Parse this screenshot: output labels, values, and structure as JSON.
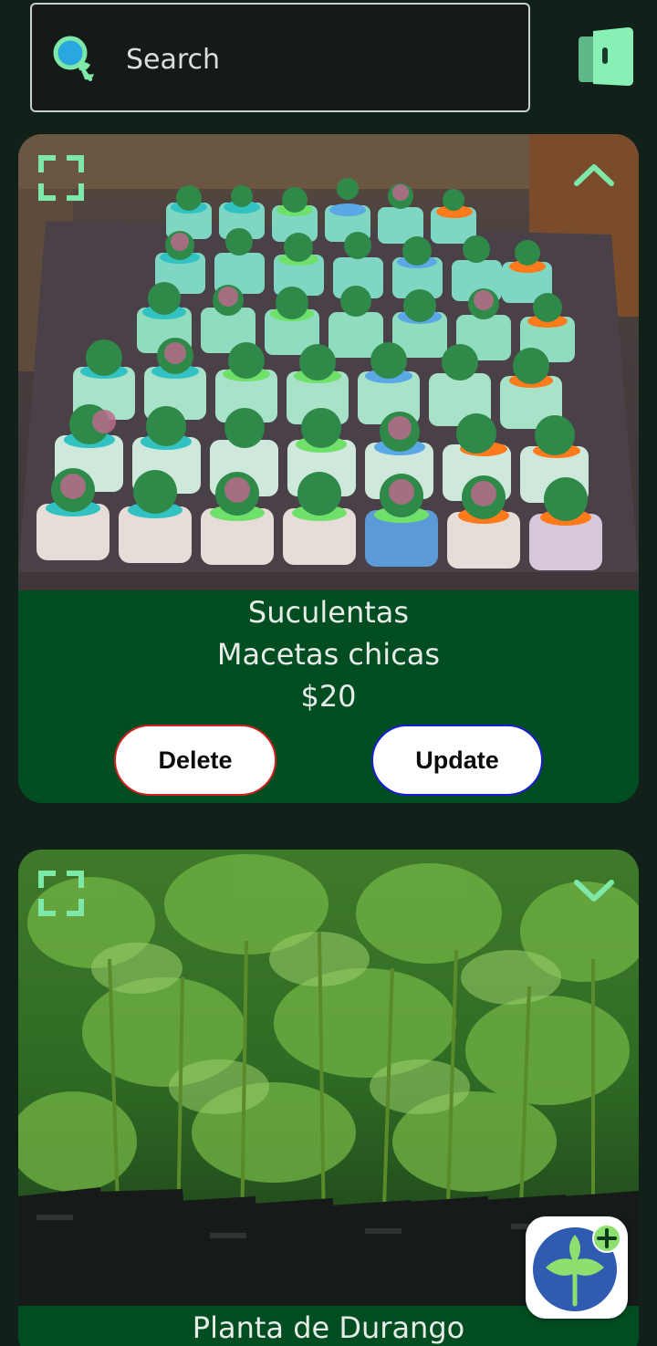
{
  "search": {
    "placeholder": "Search",
    "value": ""
  },
  "icons": {
    "search": "search-icon",
    "exit": "logout-door-icon",
    "expand": "fullscreen-expand-icon",
    "collapse": "chevron-up-icon",
    "expand_card": "chevron-down-icon",
    "add_plant": "add-plant-icon"
  },
  "cards": [
    {
      "name": "Suculentas",
      "description": "Macetas chicas",
      "price": "$20",
      "delete_label": "Delete",
      "update_label": "Update",
      "expanded": true
    },
    {
      "name": "Planta de Durango",
      "expanded": false
    }
  ],
  "colors": {
    "background": "#112019",
    "card": "#004d22",
    "accent": "#7ee8a8",
    "delete_border": "#d12020",
    "update_border": "#1a1ad8",
    "fab_circle": "#2f5bb0"
  }
}
